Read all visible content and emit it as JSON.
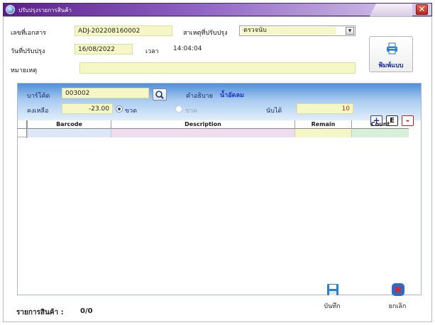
{
  "window": {
    "title": "ปรับปรุงรายการสินค้า",
    "close_glyph": "✕"
  },
  "header": {
    "doc_no_label": "เลขที่เอกสาร",
    "doc_no": "ADJ-202208160002",
    "reason_label": "สาเหตุที่ปรับปรุง",
    "reason_value": "ตรวจนับ",
    "date_label": "วันที่ปรับปรุง",
    "date": "16/08/2022",
    "time_label": "เวลา",
    "time": "14:04:04",
    "note_label": "หมายเหตุ",
    "note": ""
  },
  "print_button": {
    "label": "พิมพ์แบบ",
    "icon": "printer-icon"
  },
  "entry": {
    "barcode_label": "บาร์โค้ด",
    "barcode": "003002",
    "desc_label": "คำอธิบาย",
    "desc": "น้ำอัดลม",
    "remain_label": "คงเหลือ",
    "remain": "-23.00",
    "unit_label_1": "ขวด",
    "unit_label_2": "ขวด",
    "counted_label": "นับได้",
    "counted": "10",
    "add_label": "+",
    "edit_label": "E",
    "delete_label": "-"
  },
  "grid": {
    "columns": [
      "Barcode",
      "Description",
      "Remain",
      "Count"
    ],
    "rows": []
  },
  "actions": {
    "save_label": "บันทึก",
    "cancel_label": "ยกเลิก"
  },
  "footer": {
    "items_label": "รายการสินค้า :",
    "items_value": "0/0"
  },
  "colors": {
    "title_bar": "#5b1f8a",
    "input_fill": "#f6f7c7",
    "panel_band": "#4f8fd9",
    "accent_text": "#1a2fd0"
  }
}
